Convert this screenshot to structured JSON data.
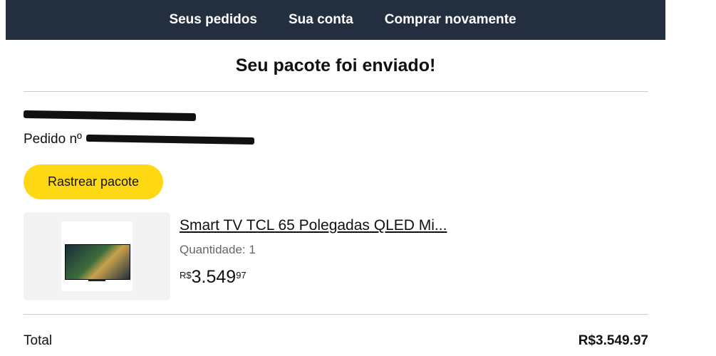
{
  "nav": {
    "orders": "Seus pedidos",
    "account": "Sua conta",
    "buy_again": "Comprar novamente"
  },
  "headline": "Seu pacote foi enviado!",
  "order": {
    "order_prefix": "Pedido nº"
  },
  "track_button": "Rastrear pacote",
  "product": {
    "title": "Smart TV TCL 65 Polegadas QLED Mi...",
    "quantity": "Quantidade: 1",
    "currency": "R$",
    "price_whole": "3.549",
    "price_cents": "97"
  },
  "total": {
    "label": "Total",
    "value": "R$3.549.97"
  },
  "colors": {
    "navbar": "#232f3e",
    "button": "#ffd814"
  }
}
